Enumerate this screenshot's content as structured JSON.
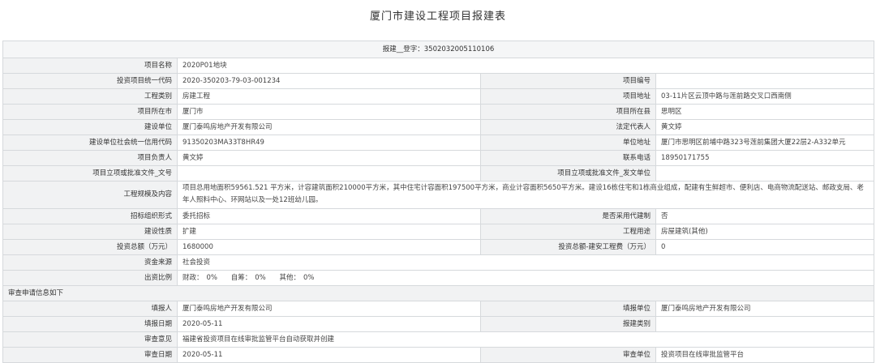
{
  "page_title": "厦门市建设工程项目报建表",
  "header": "报建__登字：35020320051101​06",
  "rows": {
    "project_name_label": "项目名称",
    "project_name": "2020P01地块",
    "invest_code_label": "投资项目统一代码",
    "invest_code": "2020-350203-79-03-001234",
    "project_no_label": "项目编号",
    "project_no": "",
    "eng_type_label": "工程类别",
    "eng_type": "房建工程",
    "address_label": "项目地址",
    "address": "03-11片区云顶中路与莲前路交叉口西南侧",
    "city_label": "项目所在市",
    "city": "厦门市",
    "county_label": "项目所在县",
    "county": "思明区",
    "builder_label": "建设单位",
    "builder": "厦门泰鸣房地产开发有限公司",
    "legal_rep_label": "法定代表人",
    "legal_rep": "黄文婷",
    "credit_code_label": "建设单位社会统一信用代码",
    "credit_code": "91350203MA33T8HR49",
    "unit_addr_label": "单位地址",
    "unit_addr": "厦门市思明区前埔中路323号莲前集团大厦22层2-A332单元",
    "leader_label": "项目负责人",
    "leader": "黄文婷",
    "phone_label": "联系电话",
    "phone": "18950171755",
    "approval_doc_label": "项目立项或批准文件_文号",
    "approval_doc": "",
    "approval_unit_label": "项目立项或批准文件_发文单位",
    "approval_unit": "",
    "scale_label": "工程规模及内容",
    "scale": "项目总用地面积59561.521 平方米，计容建筑面积210000平方米，其中住宅计容面积197500平方米，商业计容面积5650平方米。建设16栋住宅和1栋商业组成，配建有生鲜超市、便利店、电商物流配送站、邮政支局、老年人照料中心、环网站以及一处12班幼儿园。",
    "bid_form_label": "招标组织形式",
    "bid_form": "委托招标",
    "agent_label": "是否采用代建制",
    "agent": "否",
    "nature_label": "建设性质",
    "nature": "扩建",
    "usage_label": "工程用途",
    "usage": "房屋建筑(其他)",
    "total_invest_label": "投资总额（万元）",
    "total_invest": "1680000",
    "install_fee_label": "投资总额-建安工程费（万元）",
    "install_fee": "0",
    "fund_label": "资金来源",
    "fund": "社会投资",
    "ratio_label": "出资比例",
    "ratio_fiscal": "财政：",
    "ratio_fiscal_v": "0%",
    "ratio_self": "自筹：",
    "ratio_self_v": "0%",
    "ratio_other": "其他：",
    "ratio_other_v": "0%"
  },
  "review": {
    "section": "审查申请信息如下",
    "filler_label": "填报人",
    "filler": "厦门泰鸣房地产开发有限公司",
    "filler_unit_label": "填报单位",
    "filler_unit": "厦门泰鸣房地产开发有限公司",
    "fill_date_label": "填报日期",
    "fill_date": "2020-05-11",
    "report_type_label": "报建类别",
    "report_type": "",
    "opinion_label": "审查意见",
    "opinion": "福建省投资项目在线审批监管平台自动获取并创建",
    "review_date_label": "审查日期",
    "review_date": "2020-05-11",
    "review_unit_label": "审查单位",
    "review_unit": "投资项目在线审批监管平台"
  }
}
